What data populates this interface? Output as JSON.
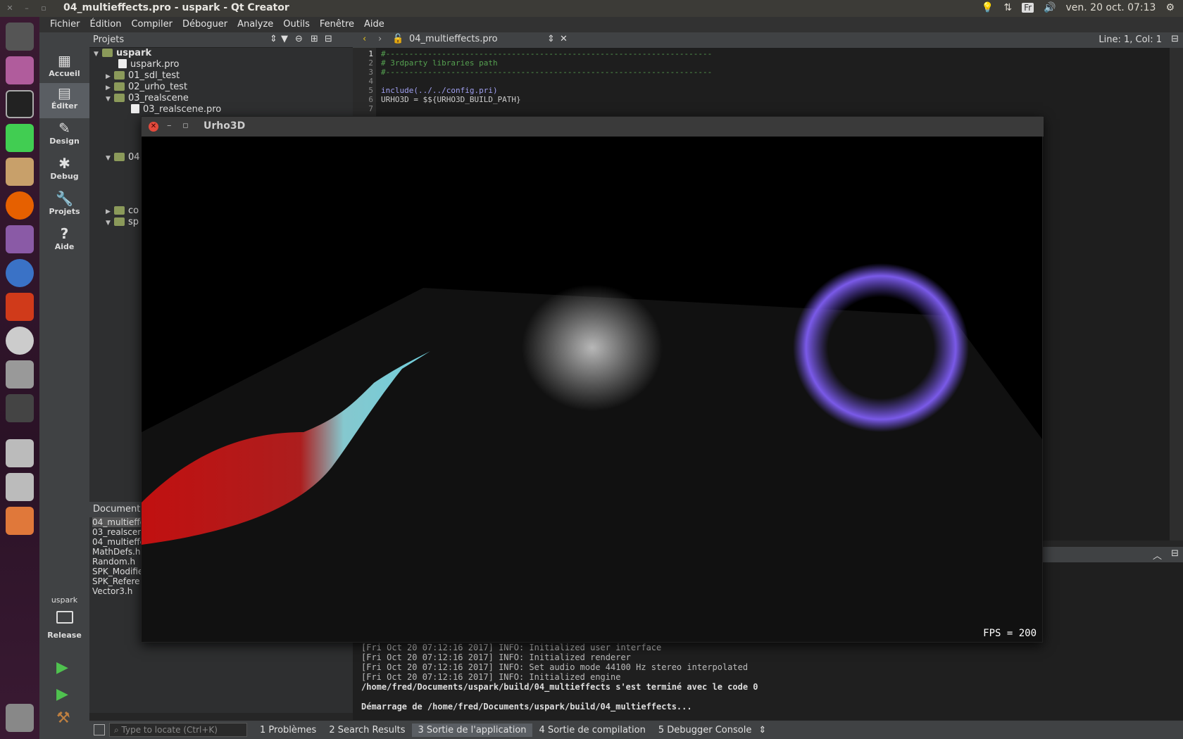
{
  "topbar": {
    "title": "04_multieffects.pro - uspark - Qt Creator",
    "lang": "Fr",
    "clock": "ven. 20 oct. 07:13"
  },
  "menu": [
    "Fichier",
    "Édition",
    "Compiler",
    "Déboguer",
    "Analyze",
    "Outils",
    "Fenêtre",
    "Aide"
  ],
  "modes": [
    {
      "label": "Accueil",
      "icon": "grid-icon"
    },
    {
      "label": "Éditer",
      "icon": "edit-icon"
    },
    {
      "label": "Design",
      "icon": "pencil-icon"
    },
    {
      "label": "Debug",
      "icon": "bug-icon"
    },
    {
      "label": "Projets",
      "icon": "wrench-icon"
    },
    {
      "label": "Aide",
      "icon": "help-icon"
    }
  ],
  "kit": {
    "project": "uspark",
    "build": "Release"
  },
  "projects": {
    "title": "Projets",
    "tree": [
      "uspark",
      "uspark.pro",
      "01_sdl_test",
      "02_urho_test",
      "03_realscene",
      "03_realscene.pro",
      "04",
      "co",
      "sp"
    ]
  },
  "documents": {
    "title": "Documents",
    "items": [
      "04_multieffe",
      "03_realscer",
      "04_multieffe",
      "MathDefs.h",
      "Random.h",
      "SPK_Modifie",
      "SPK_Refere",
      "Vector3.h"
    ]
  },
  "editor": {
    "filename": "04_multieffects.pro",
    "position": "Line: 1, Col: 1",
    "lines": [
      "#----------------------------------------------------------------------",
      "# 3rdparty libraries path",
      "#----------------------------------------------------------------------",
      "",
      "include(../../config.pri)",
      "URHO3D = $${URHO3D_BUILD_PATH}",
      ""
    ],
    "numbers": [
      "1",
      "2",
      "3",
      "4",
      "5",
      "6",
      "7"
    ]
  },
  "output": {
    "lines": [
      "[Fri Oct 20 07:12:16 2017] INFO: Initialized user interface",
      "[Fri Oct 20 07:12:16 2017] INFO: Initialized renderer",
      "[Fri Oct 20 07:12:16 2017] INFO: Set audio mode 44100 Hz stereo interpolated",
      "[Fri Oct 20 07:12:16 2017] INFO: Initialized engine",
      "/home/fred/Documents/uspark/build/04_multieffects s'est terminé avec le code 0",
      "",
      "Démarrage de /home/fred/Documents/uspark/build/04_multieffects..."
    ]
  },
  "statusbar": {
    "locate_placeholder": "Type to locate (Ctrl+K)",
    "tabs": [
      "1  Problèmes",
      "2  Search Results",
      "3  Sortie de l'application",
      "4  Sortie de compilation",
      "5  Debugger Console"
    ]
  },
  "urho": {
    "title": "Urho3D",
    "fps": "FPS = 200"
  }
}
